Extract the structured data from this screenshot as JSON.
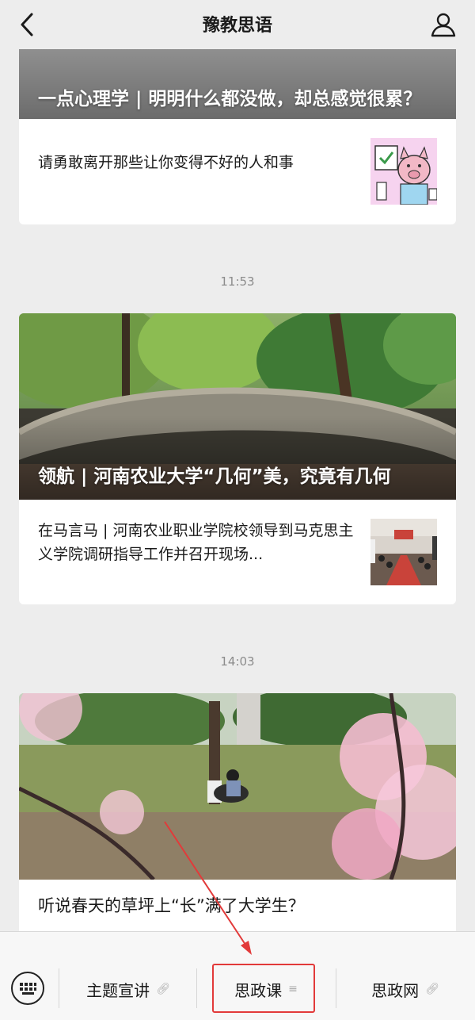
{
  "header": {
    "title": "豫教思语"
  },
  "articles": [
    {
      "hero_title": "一点心理学 | 明明什么都没做，却总感觉很累？",
      "sub_title": "请勇敢离开那些让你变得不好的人和事"
    },
    {
      "time": "11:53",
      "hero_title": "领航 | 河南农业大学“几何”美，究竟有几何",
      "sub_title": "在马言马 | 河南农业职业学院校领导到马克思主义学院调研指导工作并召开现场..."
    },
    {
      "time": "14:03",
      "title": "听说春天的草坪上“长”满了大学生？"
    }
  ],
  "menu": {
    "items": [
      {
        "label": "主题宣讲",
        "icon": "link-icon"
      },
      {
        "label": "思政课",
        "icon": "menu-lines-icon"
      },
      {
        "label": "思政网",
        "icon": "link-icon"
      }
    ]
  },
  "colors": {
    "highlight": "#e23a3a",
    "background": "#ededed"
  }
}
